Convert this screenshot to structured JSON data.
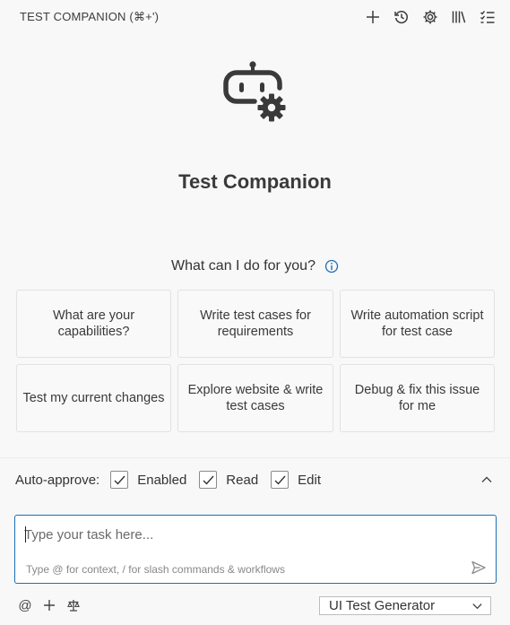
{
  "header": {
    "title": "TEST COMPANION (⌘+')",
    "actions": [
      "plus-icon",
      "history-icon",
      "gear-icon",
      "library-icon",
      "checklist-icon"
    ]
  },
  "hero": {
    "title": "Test Companion",
    "icon": "robot-gear-icon"
  },
  "prompt": {
    "text": "What can I do for you?",
    "icon": "info-icon"
  },
  "suggestions": [
    {
      "label": "What are your capabilities?"
    },
    {
      "label": "Write test cases for requirements"
    },
    {
      "label": "Write automation script for test case"
    },
    {
      "label": "Test my current changes"
    },
    {
      "label": "Explore website & write test cases"
    },
    {
      "label": "Debug & fix this issue for me"
    }
  ],
  "auto_approve": {
    "label": "Auto-approve:",
    "options": [
      {
        "label": "Enabled",
        "checked": true
      },
      {
        "label": "Read",
        "checked": true
      },
      {
        "label": "Edit",
        "checked": true
      }
    ]
  },
  "input": {
    "placeholder": "Type your task here...",
    "value": "",
    "hint": "Type @ for context, / for slash commands & workflows"
  },
  "bottom": {
    "at_label": "@",
    "mode_select": "UI Test Generator"
  },
  "colors": {
    "accent": "#1a6fb5",
    "background": "#f8f8f8",
    "card_border": "#e2e2e2"
  }
}
